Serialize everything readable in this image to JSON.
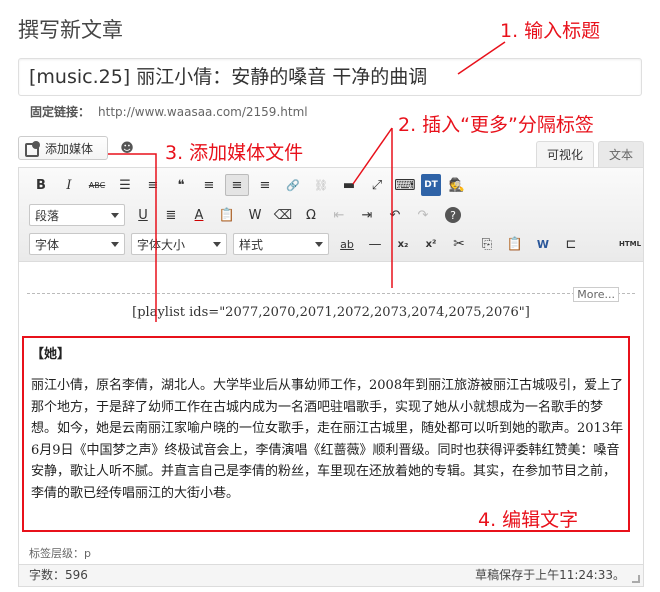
{
  "page": {
    "title": "撰写新文章"
  },
  "post": {
    "title": "[music.25] 丽江小倩：安静的嗓音 干净的曲调",
    "permalink_label": "固定链接：",
    "permalink_url": "http://www.waasaa.com/2159.html"
  },
  "media": {
    "add_label": "添加媒体",
    "smiley": "☻"
  },
  "tabs": {
    "visual": "可视化",
    "text": "文本"
  },
  "toolbar": {
    "row1": [
      {
        "name": "bold-button",
        "glyph": "B"
      },
      {
        "name": "italic-button",
        "glyph": "I"
      },
      {
        "name": "strikethrough-button",
        "glyph": "ABC"
      },
      {
        "name": "bullet-list-button",
        "glyph": "☰"
      },
      {
        "name": "numbered-list-button",
        "glyph": "≡"
      },
      {
        "name": "blockquote-button",
        "glyph": "❝"
      },
      {
        "name": "align-left-button",
        "glyph": "≡"
      },
      {
        "name": "align-center-button",
        "glyph": "≡"
      },
      {
        "name": "align-right-button",
        "glyph": "≡"
      },
      {
        "name": "insert-link-button",
        "glyph": "🔗"
      },
      {
        "name": "remove-link-button",
        "glyph": "⛓"
      },
      {
        "name": "insert-more-button",
        "glyph": "▬"
      },
      {
        "name": "fullscreen-button",
        "glyph": "⤢"
      },
      {
        "name": "toolbar-toggle-button",
        "glyph": "⌨"
      },
      {
        "name": "dt-button",
        "glyph": "DT"
      },
      {
        "name": "spy-icon-button",
        "glyph": "🕵"
      }
    ],
    "format_select": "段落",
    "row2": [
      {
        "name": "underline-button",
        "glyph": "U"
      },
      {
        "name": "justify-button",
        "glyph": "≣"
      },
      {
        "name": "text-color-button",
        "glyph": "A"
      },
      {
        "name": "paste-text-button",
        "glyph": "📋"
      },
      {
        "name": "paste-word-button",
        "glyph": "W"
      },
      {
        "name": "clear-format-button",
        "glyph": "⌫"
      },
      {
        "name": "special-char-button",
        "glyph": "Ω"
      },
      {
        "name": "outdent-button",
        "glyph": "⇤"
      },
      {
        "name": "indent-button",
        "glyph": "⇥"
      },
      {
        "name": "undo-button",
        "glyph": "↶"
      },
      {
        "name": "redo-button",
        "glyph": "↷"
      },
      {
        "name": "help-button",
        "glyph": "?"
      }
    ],
    "font_select": "字体",
    "size_select": "字体大小",
    "style_select": "样式",
    "row3": [
      {
        "name": "highlight-button",
        "glyph": "ab"
      },
      {
        "name": "horizontal-rule-button",
        "glyph": "—"
      },
      {
        "name": "subscript-button",
        "glyph": "x₂"
      },
      {
        "name": "superscript-button",
        "glyph": "x²"
      },
      {
        "name": "cut-button",
        "glyph": "✂"
      },
      {
        "name": "copy-button",
        "glyph": "⎘"
      },
      {
        "name": "paste-button",
        "glyph": "📋"
      },
      {
        "name": "paste-word2-button",
        "glyph": "W"
      },
      {
        "name": "page-break-button",
        "glyph": "⊏"
      },
      {
        "name": "html-button",
        "glyph": "HTML"
      }
    ]
  },
  "content": {
    "more_tag": "More...",
    "shortcode": "[playlist ids=\"2077,2070,2071,2072,2073,2074,2075,2076\"]",
    "heading": "【她】",
    "paragraph": "丽江小倩，原名李倩，湖北人。大学毕业后从事幼师工作，2008年到丽江旅游被丽江古城吸引，爱上了那个地方，于是辞了幼师工作在古城内成为一名酒吧驻唱歌手，实现了她从小就想成为一名歌手的梦想。如今，她是云南丽江家喻户晓的一位女歌手，走在丽江古城里，随处都可以听到她的歌声。2013年6月9日《中国梦之声》终极试音会上，李倩演唱《红蔷薇》顺利晋级。同时也获得评委韩红赞美：嗓音安静，歌让人听不腻。并直言自己是李倩的粉丝，车里现在还放着她的专辑。其实，在参加节目之前，李倩的歌已经传唱丽江的大街小巷。"
  },
  "status": {
    "path": "标签层级：p",
    "word_count": "字数：596",
    "saved": "草稿保存于上午11:24:33。"
  },
  "annotations": {
    "a1": "1. 输入标题",
    "a2": "2. 插入“更多”分隔标签",
    "a3": "3. 添加媒体文件",
    "a4": "4. 编辑文字",
    "color": "#e8111b"
  }
}
